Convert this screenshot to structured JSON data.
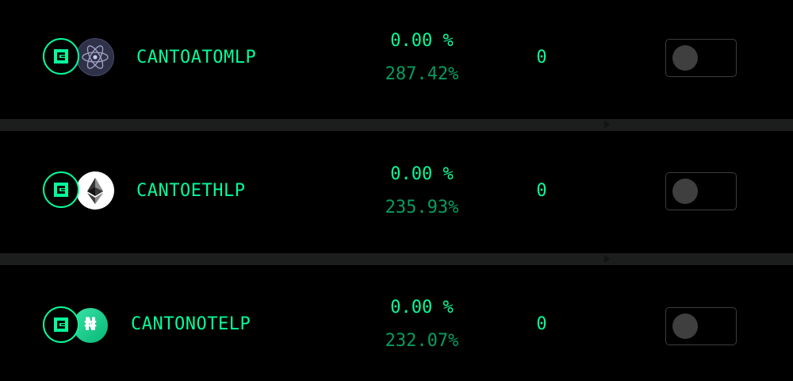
{
  "pools": [
    {
      "name": "CANTOATOMLP",
      "percent": "0.00 %",
      "apr": "287.42%",
      "balance": "0",
      "token_icon": "cosmos-atom-icon",
      "collateral_enabled": false
    },
    {
      "name": "CANTOETHLP",
      "percent": "0.00 %",
      "apr": "235.93%",
      "balance": "0",
      "token_icon": "ethereum-icon",
      "collateral_enabled": false
    },
    {
      "name": "CANTONOTELP",
      "percent": "0.00 %",
      "apr": "232.07%",
      "balance": "0",
      "token_icon": "note-icon",
      "note_glyph": "₦",
      "collateral_enabled": false
    }
  ],
  "colors": {
    "accent": "#06fc99",
    "accent_dim": "#079c5f",
    "background": "#000000",
    "divider": "#1b1e1d"
  }
}
